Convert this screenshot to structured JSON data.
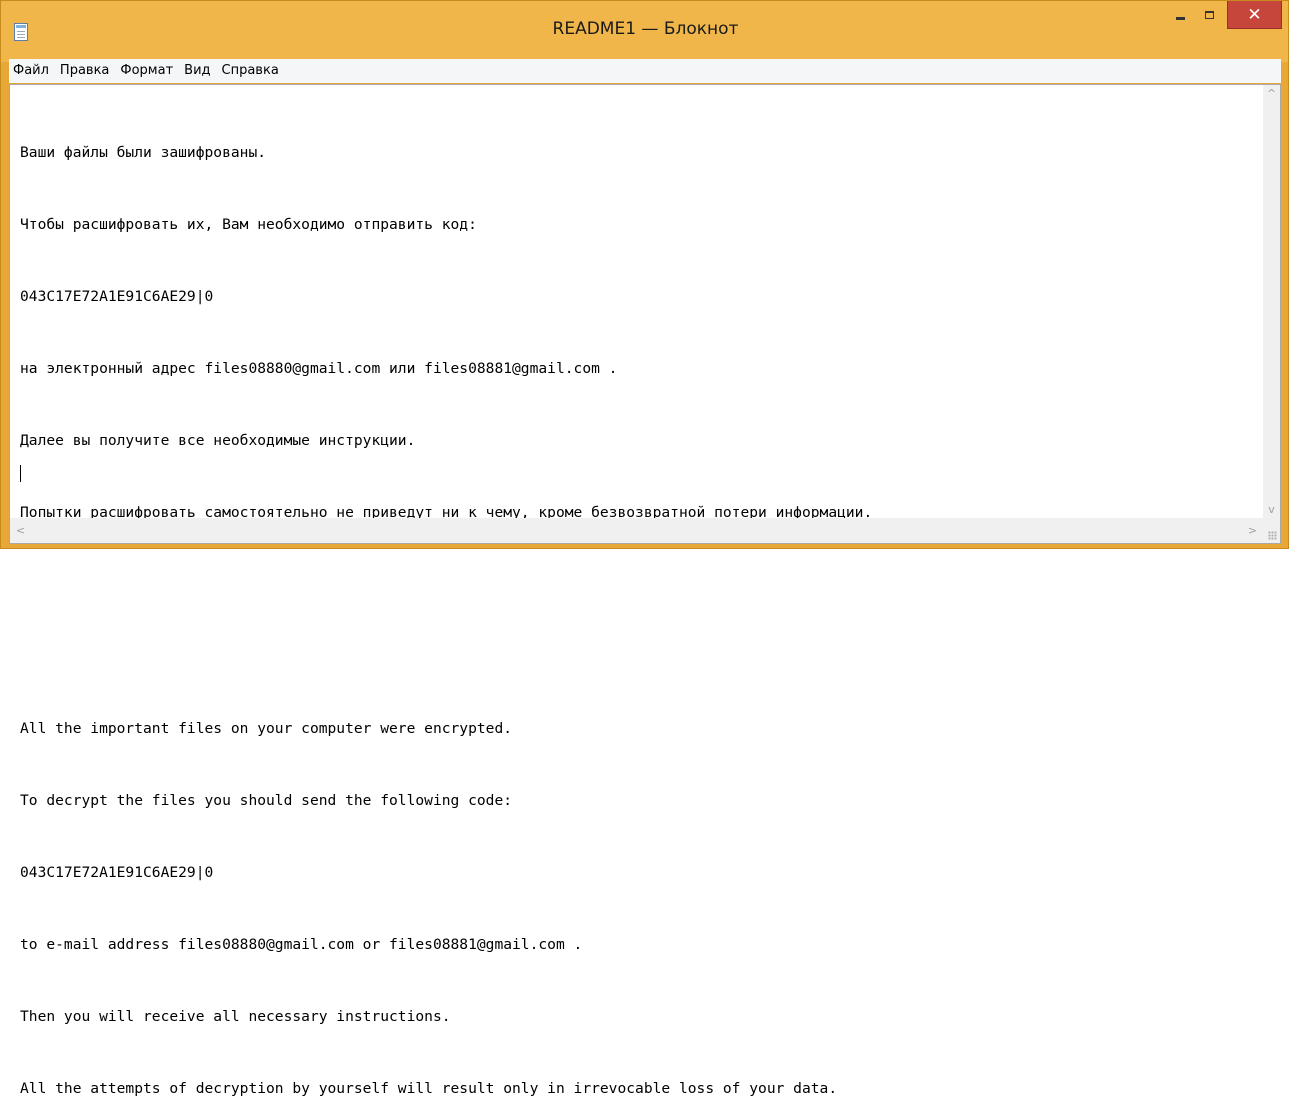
{
  "window": {
    "title": "README1 — Блокнот",
    "icons": {
      "app": "notepad-icon",
      "minimize": "minimize-icon",
      "maximize": "maximize-icon",
      "close": "close-icon"
    },
    "close_glyph": "✕",
    "colors": {
      "frame": "#f0b64a",
      "close_button": "#c7463b"
    }
  },
  "menu": {
    "file": "Файл",
    "edit": "Правка",
    "format": "Формат",
    "view": "Вид",
    "help": "Справка"
  },
  "document": {
    "lines": [
      "Ваши файлы были зашифрованы.",
      "Чтобы расшифровать их, Вам необходимо отправить код:",
      "043C17E72A1E91C6AE29|0",
      "на электронный адрес files08880@gmail.com или files08881@gmail.com .",
      "Далее вы получите все необходимые инструкции.",
      "Попытки расшифровать самостоятельно не приведут ни к чему, кроме безвозвратной потери информации.",
      "",
      "",
      "All the important files on your computer were encrypted.",
      "To decrypt the files you should send the following code:",
      "043C17E72A1E91C6AE29|0",
      "to e-mail address files08880@gmail.com or files08881@gmail.com .",
      "Then you will receive all necessary instructions.",
      "All the attempts of decryption by yourself will result only in irrevocable loss of your data."
    ]
  },
  "scrollbars": {
    "up_arrow": "^",
    "down_arrow": "v",
    "left_arrow": "<",
    "right_arrow": ">"
  }
}
